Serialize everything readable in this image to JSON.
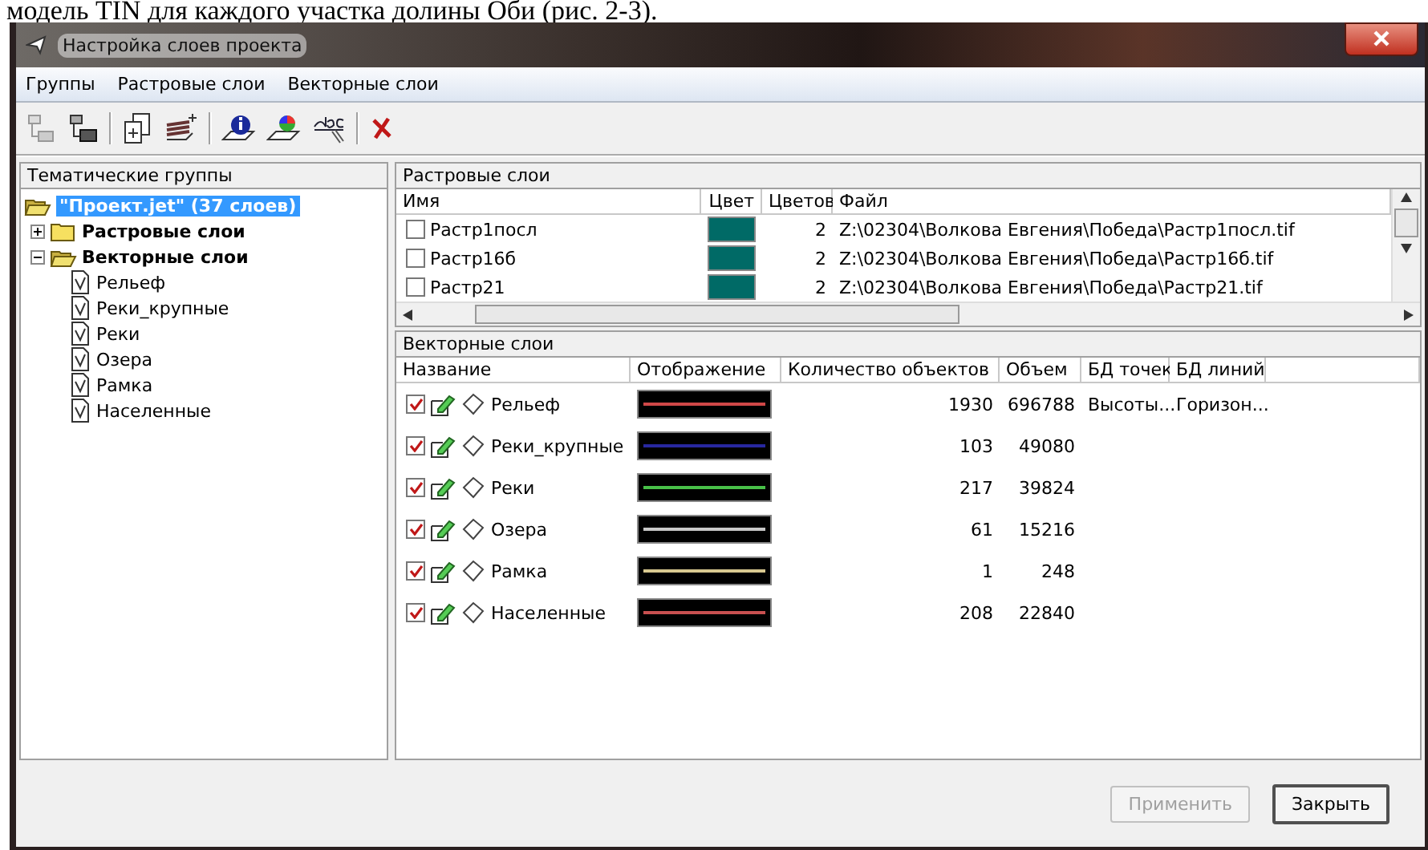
{
  "document_text": "модель TIN для каждого участка долины Оби (рис. 2-3).",
  "window": {
    "title": "Настройка слоев проекта"
  },
  "menu": [
    "Группы",
    "Растровые слои",
    "Векторные слои"
  ],
  "groups_panel": {
    "title": "Тематические группы",
    "tree": [
      {
        "label": "\"Проект.jet\" (37 слоев)",
        "kind": "project",
        "selected": true,
        "children": [
          {
            "label": "Растровые слои",
            "kind": "folder",
            "expanded": false,
            "selected": false
          },
          {
            "label": "Векторные слои",
            "kind": "folder",
            "expanded": true,
            "selected": false,
            "children": [
              {
                "label": "Рельеф",
                "kind": "layer",
                "selected": false
              },
              {
                "label": "Реки_крупные",
                "kind": "layer",
                "selected": false
              },
              {
                "label": "Реки",
                "kind": "layer",
                "selected": false
              },
              {
                "label": "Озера",
                "kind": "layer",
                "selected": false
              },
              {
                "label": "Рамка",
                "kind": "layer",
                "selected": false
              },
              {
                "label": "Населенные",
                "kind": "layer",
                "selected": false
              }
            ]
          }
        ]
      }
    ]
  },
  "raster_panel": {
    "title": "Растровые слои",
    "columns": [
      "Имя",
      "Цвет",
      "Цветов",
      "Файл"
    ],
    "rows": [
      {
        "name": "Растр1посл",
        "checked": false,
        "color": "#006a66",
        "colors": "2",
        "file": "Z:\\02304\\Волкова Евгения\\Победа\\Растр1посл.tif"
      },
      {
        "name": "Растр16б",
        "checked": false,
        "color": "#006a66",
        "colors": "2",
        "file": "Z:\\02304\\Волкова Евгения\\Победа\\Растр16б.tif"
      },
      {
        "name": "Растр21",
        "checked": false,
        "color": "#006a66",
        "colors": "2",
        "file": "Z:\\02304\\Волкова Евгения\\Победа\\Растр21.tif"
      }
    ]
  },
  "vector_panel": {
    "title": "Векторные слои",
    "columns": [
      "Название",
      "Отображение",
      "Количество объектов",
      "Объем",
      "БД точек",
      "БД линий"
    ],
    "rows": [
      {
        "name": "Рельеф",
        "checked": true,
        "color": "#d04848",
        "count": "1930",
        "volume": "696788",
        "db_points": "Высоты...",
        "db_lines": "Горизон..."
      },
      {
        "name": "Реки_крупные",
        "checked": true,
        "color": "#2828a0",
        "count": "103",
        "volume": "49080"
      },
      {
        "name": "Реки",
        "checked": true,
        "color": "#48c048",
        "count": "217",
        "volume": "39824"
      },
      {
        "name": "Озера",
        "checked": true,
        "color": "#c8c8c8",
        "count": "61",
        "volume": "15216"
      },
      {
        "name": "Рамка",
        "checked": true,
        "color": "#d8c890",
        "count": "1",
        "volume": "248"
      },
      {
        "name": "Населенные",
        "checked": true,
        "color": "#c85050",
        "count": "208",
        "volume": "22840"
      }
    ]
  },
  "buttons": [
    {
      "label": "Применить",
      "disabled": true
    },
    {
      "label": "Закрыть",
      "disabled": false
    }
  ]
}
